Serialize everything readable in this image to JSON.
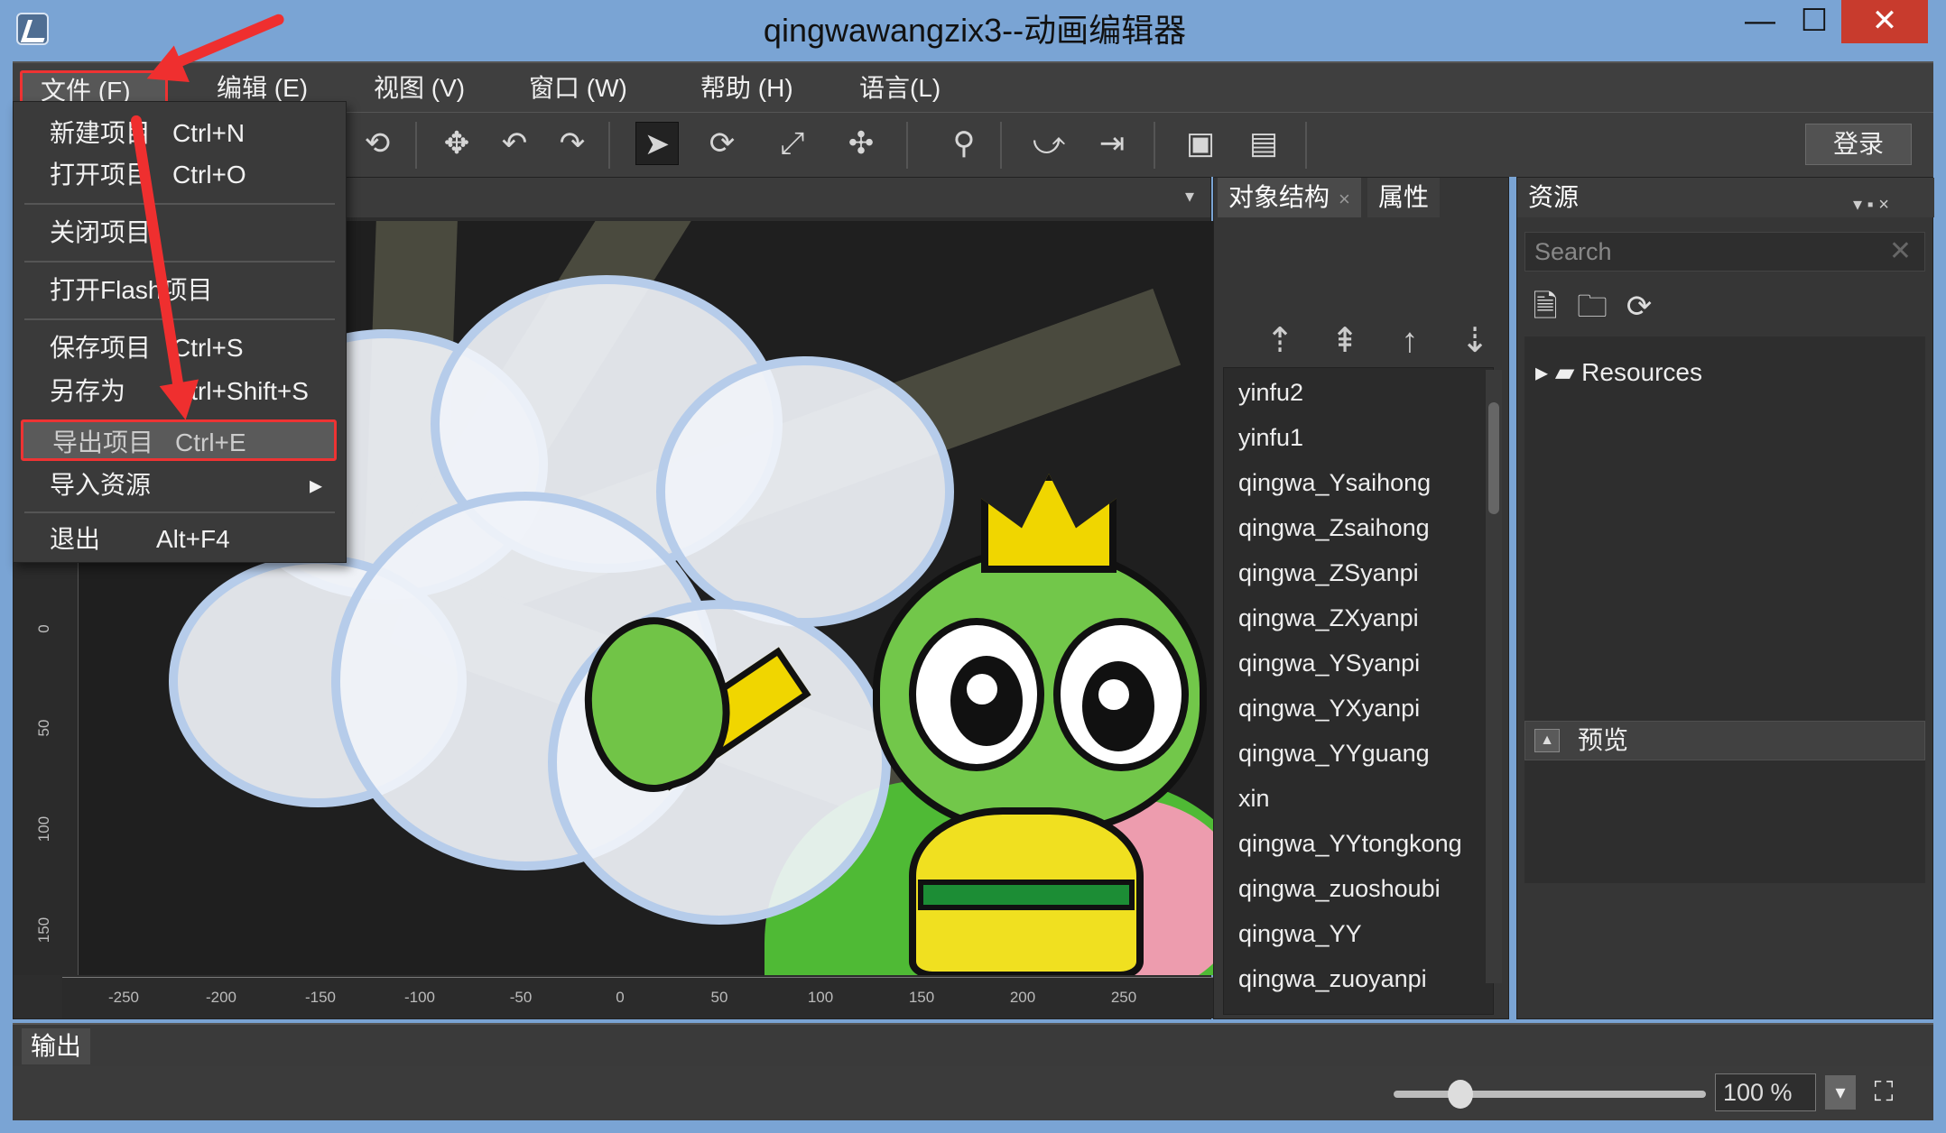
{
  "window": {
    "title": "qingwawangzix3--动画编辑器",
    "minimize": "—",
    "maximize": "☐",
    "close": "✕"
  },
  "menu": {
    "file": "文件 (F)",
    "edit": "编辑 (E)",
    "view": "视图 (V)",
    "window": "窗口 (W)",
    "help": "帮助 (H)",
    "language": "语言(L)"
  },
  "file_menu": [
    {
      "label": "新建项目",
      "shortcut": "Ctrl+N"
    },
    {
      "label": "打开项目",
      "shortcut": "Ctrl+O"
    },
    {
      "label": "关闭项目",
      "shortcut": ""
    },
    {
      "label": "打开Flash项目",
      "shortcut": ""
    },
    {
      "label": "保存项目",
      "shortcut": "Ctrl+S"
    },
    {
      "label": "另存为",
      "shortcut": "Ctrl+Shift+S"
    },
    {
      "label": "导出项目",
      "shortcut": "Ctrl+E"
    },
    {
      "label": "导入资源",
      "shortcut": "▸"
    },
    {
      "label": "退出",
      "shortcut": "Alt+F4"
    }
  ],
  "toolbar": {
    "login": "登录",
    "icons": [
      "lasso-icon",
      "move-icon",
      "rotate-left-icon",
      "rotate-right-icon",
      "select-arrow-icon",
      "cycle-icon",
      "scale-icon",
      "skeleton-icon",
      "bone-icon",
      "ik-icon",
      "jump-icon",
      "export-frame-icon",
      "image-export-icon"
    ]
  },
  "panels": {
    "object_tab": "对象结构",
    "property_tab": "属性",
    "resource_tab": "资源",
    "search_placeholder": "Search",
    "resources_root": "Resources",
    "preview": "预览",
    "output": "输出"
  },
  "objects": [
    "yinfu2",
    "yinfu1",
    "qingwa_Ysaihong",
    "qingwa_Zsaihong",
    "qingwa_ZSyanpi",
    "qingwa_ZXyanpi",
    "qingwa_YSyanpi",
    "qingwa_YXyanpi",
    "qingwa_YYguang",
    "xin",
    "qingwa_YYtongkong",
    "qingwa_zuoshoubi",
    "qingwa_YY",
    "qingwa_zuoyanpi"
  ],
  "rulers": {
    "bottom": [
      "-250",
      "-200",
      "-150",
      "-100",
      "-50",
      "0",
      "50",
      "100",
      "150",
      "200",
      "250"
    ],
    "left": [
      "0",
      "50",
      "100",
      "150"
    ]
  },
  "zoom": "100 %"
}
